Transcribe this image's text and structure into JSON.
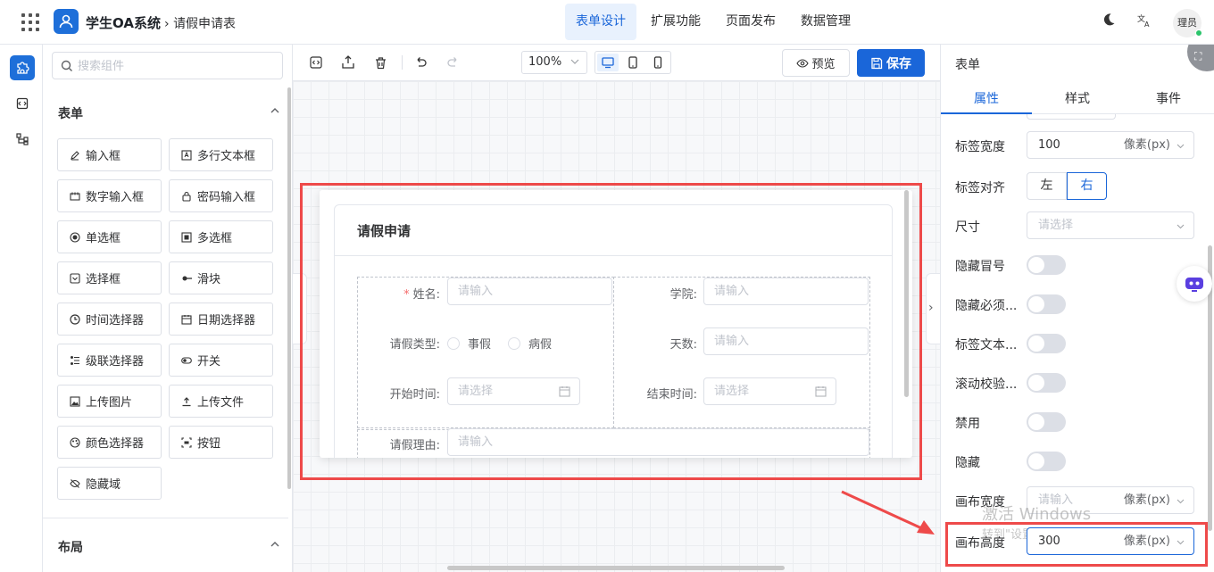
{
  "header": {
    "app_title": "学生OA系统",
    "breadcrumb": "请假申请表",
    "nav_tabs": [
      {
        "label": "表单设计",
        "active": true
      },
      {
        "label": "扩展功能",
        "active": false
      },
      {
        "label": "页面发布",
        "active": false
      },
      {
        "label": "数据管理",
        "active": false
      }
    ],
    "icons": [
      "apps-grid-icon",
      "moon-icon",
      "translate-icon"
    ],
    "avatar_text": "理员"
  },
  "rail": {
    "items": [
      "puzzle-icon",
      "code-brackets-icon",
      "tree-structure-icon"
    ]
  },
  "components_panel": {
    "search_placeholder": "搜索组件",
    "group_form": "表单",
    "group_layout": "布局",
    "items": [
      {
        "label": "输入框",
        "icon": "pencil-icon"
      },
      {
        "label": "多行文本框",
        "icon": "textarea-icon"
      },
      {
        "label": "数字输入框",
        "icon": "number-input-icon"
      },
      {
        "label": "密码输入框",
        "icon": "lock-icon"
      },
      {
        "label": "单选框",
        "icon": "radio-icon"
      },
      {
        "label": "多选框",
        "icon": "checkbox-icon"
      },
      {
        "label": "选择框",
        "icon": "select-icon"
      },
      {
        "label": "滑块",
        "icon": "slider-icon"
      },
      {
        "label": "时间选择器",
        "icon": "clock-icon"
      },
      {
        "label": "日期选择器",
        "icon": "calendar-icon"
      },
      {
        "label": "级联选择器",
        "icon": "cascader-icon"
      },
      {
        "label": "开关",
        "icon": "switch-icon"
      },
      {
        "label": "上传图片",
        "icon": "image-icon"
      },
      {
        "label": "上传文件",
        "icon": "upload-icon"
      },
      {
        "label": "颜色选择器",
        "icon": "palette-icon"
      },
      {
        "label": "按钮",
        "icon": "button-icon"
      },
      {
        "label": "隐藏域",
        "icon": "eye-off-icon"
      }
    ]
  },
  "toolbar": {
    "zoom": "100%",
    "preview_label": "预览",
    "save_label": "保存",
    "icons": [
      "code-icon",
      "import-icon",
      "trash-icon",
      "undo-icon",
      "redo-icon",
      "desktop-icon",
      "tablet-icon",
      "mobile-icon",
      "eye-icon",
      "save-icon"
    ]
  },
  "form_preview": {
    "card_title": "请假申请",
    "fields": {
      "name_label": "姓名:",
      "name_placeholder": "请输入",
      "college_label": "学院:",
      "college_placeholder": "请输入",
      "leave_type_label": "请假类型:",
      "leave_type_options": [
        "事假",
        "病假"
      ],
      "days_label": "天数:",
      "days_placeholder": "请输入",
      "start_label": "开始时间:",
      "start_placeholder": "请选择",
      "end_label": "结束时间:",
      "end_placeholder": "请选择",
      "reason_label": "请假理由:",
      "reason_placeholder": "请输入"
    }
  },
  "properties": {
    "title": "表单",
    "tabs": [
      "属性",
      "样式",
      "事件"
    ],
    "active_tab": "属性",
    "label_width_label": "标签宽度",
    "label_width_value": "100",
    "unit_px": "像素(px)",
    "label_align_label": "标签对齐",
    "align_options": [
      "左",
      "右"
    ],
    "align_selected": "右",
    "size_label": "尺寸",
    "size_placeholder": "请选择",
    "toggles": [
      {
        "label": "隐藏冒号",
        "on": false
      },
      {
        "label": "隐藏必须...",
        "on": false
      },
      {
        "label": "标签文本...",
        "on": false
      },
      {
        "label": "滚动校验...",
        "on": false
      },
      {
        "label": "禁用",
        "on": false
      },
      {
        "label": "隐藏",
        "on": false
      }
    ],
    "canvas_width_label": "画布宽度",
    "canvas_width_placeholder": "请输入",
    "canvas_height_label": "画布高度",
    "canvas_height_value": "300"
  },
  "watermark": {
    "line1": "激活 Windows",
    "line2": "转到\"设置\"以激活 Windows。"
  },
  "colors": {
    "primary": "#1a66d9",
    "highlight_red": "#ee4a4a",
    "required_red": "#f56c6c"
  }
}
